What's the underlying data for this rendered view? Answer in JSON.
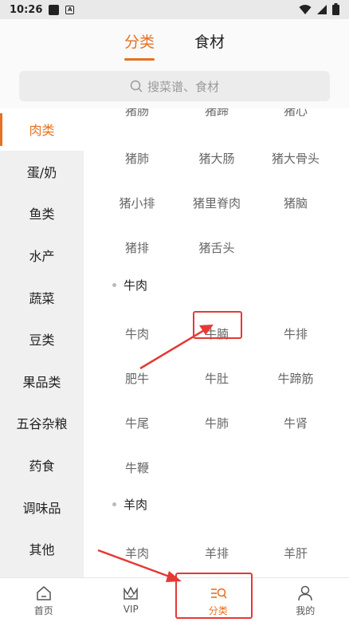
{
  "statusbar": {
    "time": "10:26"
  },
  "tabs": [
    {
      "label": "分类",
      "active": true
    },
    {
      "label": "食材",
      "active": false
    }
  ],
  "search": {
    "placeholder": "搜菜谱、食材"
  },
  "sidebar": {
    "items": [
      {
        "label": "肉类",
        "active": true
      },
      {
        "label": "蛋/奶"
      },
      {
        "label": "鱼类"
      },
      {
        "label": "水产"
      },
      {
        "label": "蔬菜"
      },
      {
        "label": "豆类"
      },
      {
        "label": "果品类"
      },
      {
        "label": "五谷杂粮"
      },
      {
        "label": "药食"
      },
      {
        "label": "调味品"
      },
      {
        "label": "其他"
      }
    ]
  },
  "content": {
    "partial_row": [
      "猪肠",
      "猪蹄",
      "猪心"
    ],
    "pork_rows": [
      [
        "猪肺",
        "猪大肠",
        "猪大骨头"
      ],
      [
        "猪小排",
        "猪里脊肉",
        "猪脑"
      ],
      [
        "猪排",
        "猪舌头",
        ""
      ]
    ],
    "beef_title": "牛肉",
    "beef_rows": [
      [
        "牛肉",
        "牛腩",
        "牛排"
      ],
      [
        "肥牛",
        "牛肚",
        "牛蹄筋"
      ],
      [
        "牛尾",
        "牛肺",
        "牛肾"
      ],
      [
        "牛鞭",
        "",
        ""
      ]
    ],
    "lamb_title": "羊肉",
    "lamb_rows": [
      [
        "羊肉",
        "羊排",
        "羊肝"
      ]
    ]
  },
  "bottom_nav": [
    {
      "label": "首页",
      "icon": "home-icon"
    },
    {
      "label": "VIP",
      "icon": "crown-icon"
    },
    {
      "label": "分类",
      "icon": "category-icon",
      "active": true
    },
    {
      "label": "我的",
      "icon": "user-icon"
    }
  ],
  "colors": {
    "accent": "#e8711e",
    "annotation": "#e53935"
  }
}
